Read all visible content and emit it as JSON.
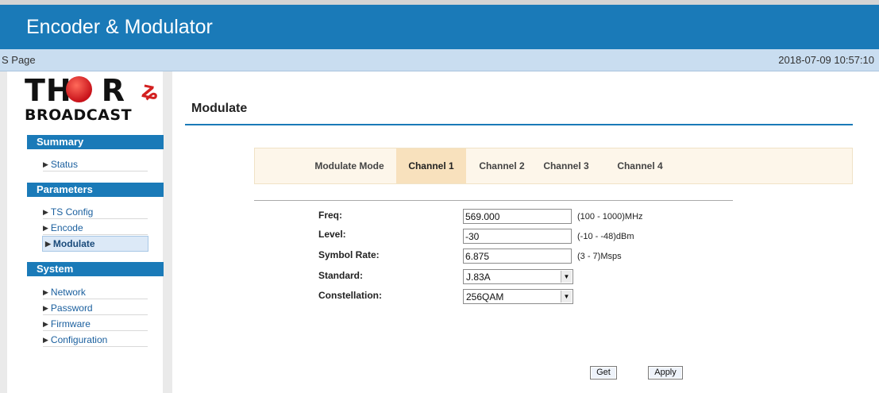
{
  "app": {
    "title": "Encoder & Modulator"
  },
  "subbar": {
    "page_label": "S Page",
    "datetime": "2018-07-09 10:57:10"
  },
  "logo": {
    "line1_left": "TH",
    "line1_right": "R",
    "line2": "BROADCAST"
  },
  "sidebar": {
    "sections": [
      {
        "title": "Summary",
        "items": [
          {
            "label": "Status"
          }
        ]
      },
      {
        "title": "Parameters",
        "items": [
          {
            "label": "TS Config"
          },
          {
            "label": "Encode"
          },
          {
            "label": "Modulate"
          }
        ]
      },
      {
        "title": "System",
        "items": [
          {
            "label": "Network"
          },
          {
            "label": "Password"
          },
          {
            "label": "Firmware"
          },
          {
            "label": "Configuration"
          }
        ]
      }
    ]
  },
  "main": {
    "title": "Modulate",
    "tabs": [
      {
        "label": "Modulate Mode"
      },
      {
        "label": "Channel 1"
      },
      {
        "label": "Channel 2"
      },
      {
        "label": "Channel 3"
      },
      {
        "label": "Channel 4"
      }
    ],
    "fields": {
      "freq": {
        "label": "Freq:",
        "value": "569.000",
        "range": "(100 - 1000)MHz"
      },
      "level": {
        "label": "Level:",
        "value": "-30",
        "range": "(-10 - -48)dBm"
      },
      "symbol_rate": {
        "label": "Symbol Rate:",
        "value": "6.875",
        "range": "(3 - 7)Msps"
      },
      "standard": {
        "label": "Standard:",
        "value": "J.83A"
      },
      "constellation": {
        "label": "Constellation:",
        "value": "256QAM"
      }
    },
    "buttons": {
      "get": "Get",
      "apply": "Apply"
    }
  },
  "colors": {
    "accent": "#1a7ab8",
    "tab_active": "#f8e1bd",
    "tab_bg": "#fdf6ea"
  }
}
